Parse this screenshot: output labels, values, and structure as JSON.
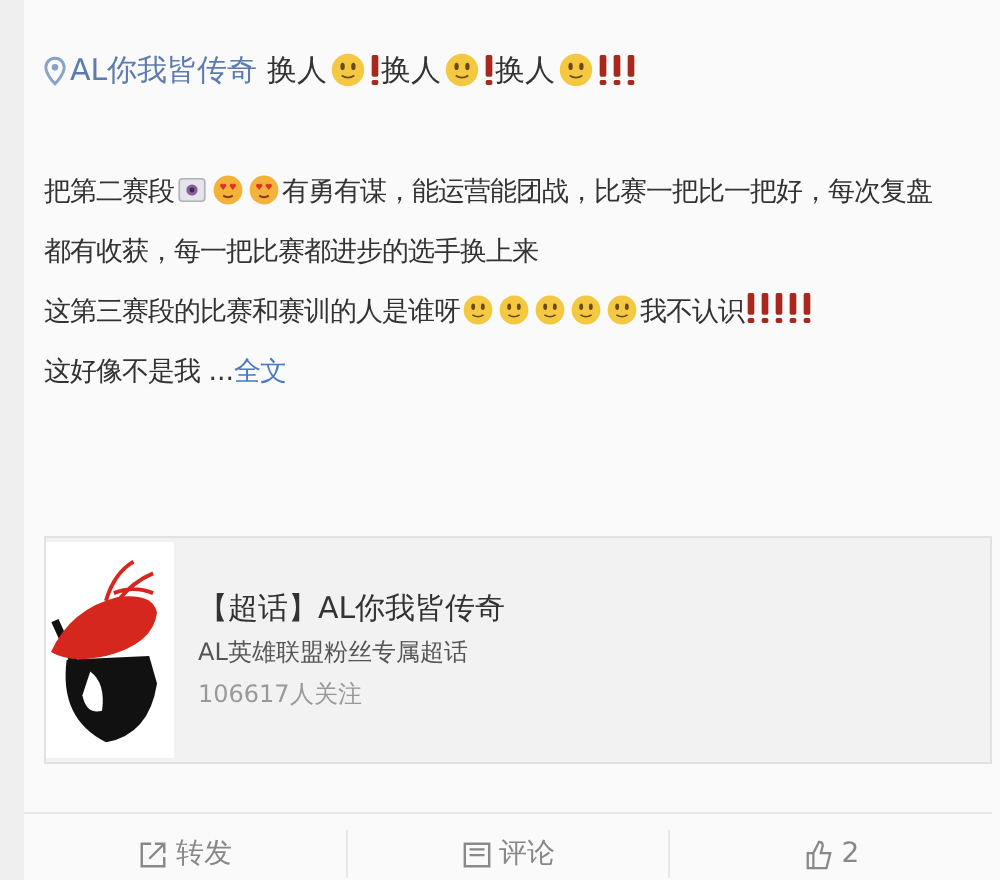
{
  "topic_line": {
    "topic": "AL你我皆传奇",
    "parts": [
      {
        "kind": "text",
        "text": "换人"
      },
      {
        "kind": "smile"
      },
      {
        "kind": "exclaim"
      },
      {
        "kind": "text",
        "text": "换人"
      },
      {
        "kind": "smile"
      },
      {
        "kind": "exclaim"
      },
      {
        "kind": "text",
        "text": "换人"
      },
      {
        "kind": "smile"
      },
      {
        "kind": "exclaim"
      },
      {
        "kind": "exclaim"
      },
      {
        "kind": "exclaim"
      }
    ]
  },
  "paragraphs": [
    [
      {
        "kind": "text",
        "text": "把第二赛段"
      },
      {
        "kind": "camera"
      },
      {
        "kind": "love"
      },
      {
        "kind": "love"
      },
      {
        "kind": "text",
        "text": "有勇有谋，能运营能团战，比赛一把比一把好，每次复盘"
      }
    ],
    [
      {
        "kind": "text",
        "text": "都有收获，每一把比赛都进步的选手换上来"
      }
    ],
    [
      {
        "kind": "text",
        "text": "这第三赛段的比赛和赛训的人是谁呀"
      },
      {
        "kind": "smile"
      },
      {
        "kind": "smile"
      },
      {
        "kind": "smile"
      },
      {
        "kind": "smile"
      },
      {
        "kind": "smile"
      },
      {
        "kind": "text",
        "text": "我不认识"
      },
      {
        "kind": "exclaim"
      },
      {
        "kind": "exclaim"
      },
      {
        "kind": "exclaim"
      },
      {
        "kind": "exclaim"
      },
      {
        "kind": "exclaim"
      }
    ],
    [
      {
        "kind": "text",
        "text": "这好像不是我 ..."
      },
      {
        "kind": "link",
        "text": "全文"
      }
    ]
  ],
  "topic_card": {
    "title": "【超话】AL你我皆传奇",
    "description": "AL英雄联盟粉丝专属超话",
    "followers": "106617人关注"
  },
  "actions": [
    {
      "kind": "repost",
      "label": "转发"
    },
    {
      "kind": "comment",
      "label": "评论"
    },
    {
      "kind": "like",
      "label": "2"
    }
  ]
}
